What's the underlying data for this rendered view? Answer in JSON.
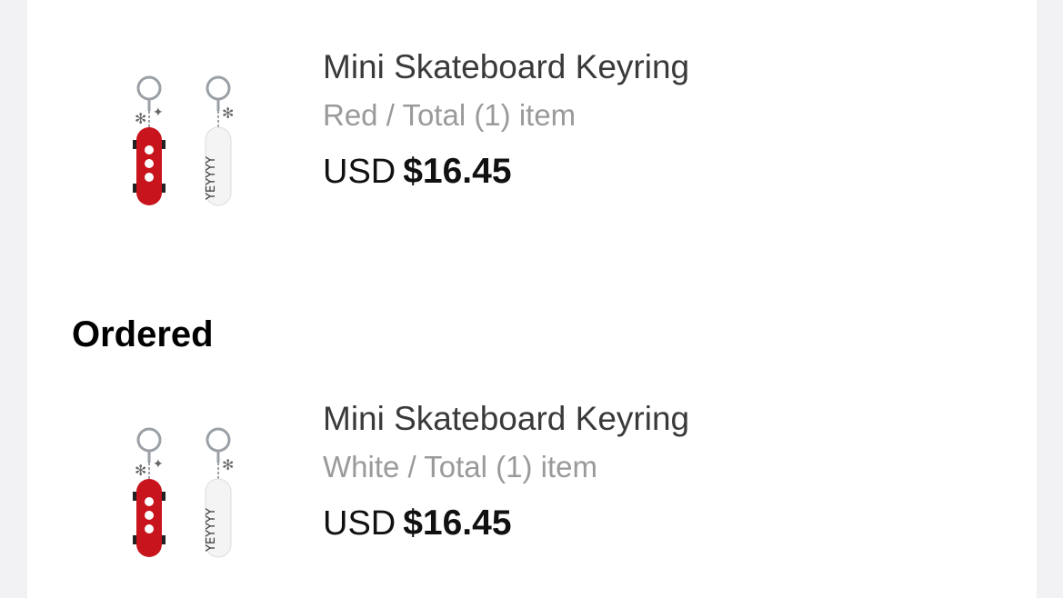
{
  "items": [
    {
      "name": "Mini Skateboard Keyring",
      "variant": "Red / Total (1) item",
      "currency": "USD",
      "price": "$16.45",
      "image_icon": "keyring-product-image"
    },
    {
      "name": "Mini Skateboard Keyring",
      "variant": "White / Total (1) item",
      "currency": "USD",
      "price": "$16.45",
      "image_icon": "keyring-product-image"
    }
  ],
  "sections": {
    "ordered_title": "Ordered"
  },
  "colors": {
    "accent_red": "#c8141c",
    "price_text": "#111111",
    "muted_text": "#9a9a9a"
  }
}
